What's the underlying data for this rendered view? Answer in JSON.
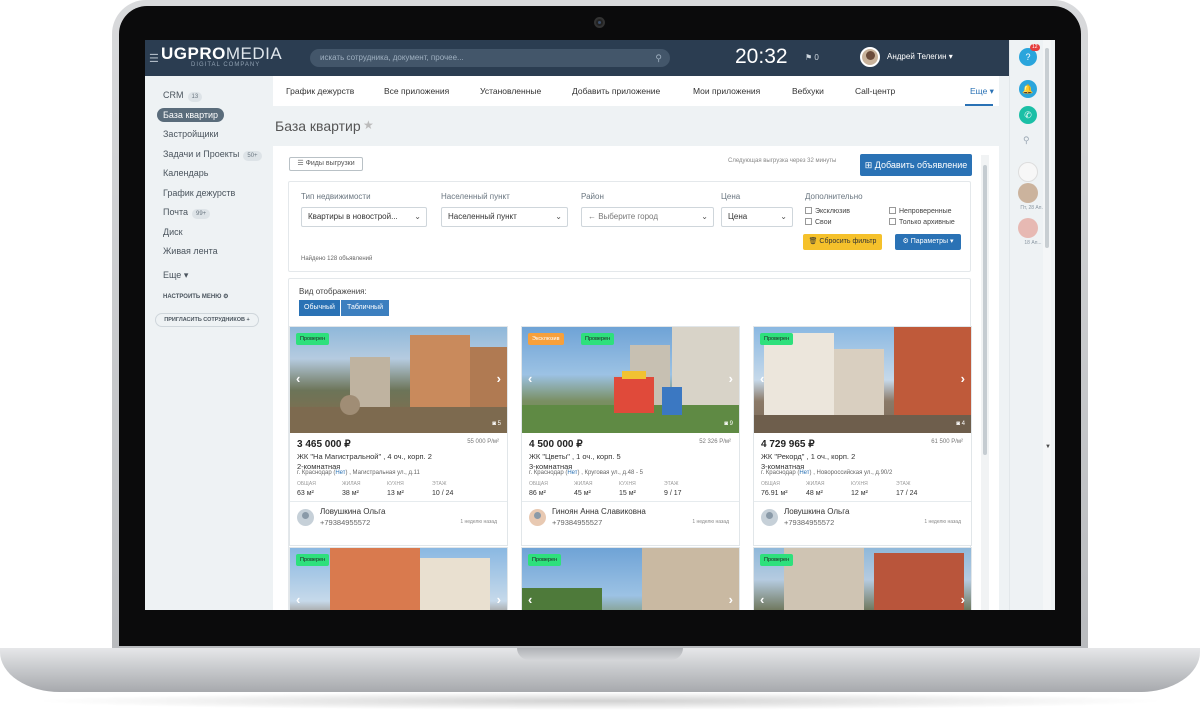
{
  "header": {
    "logo_bold": "UGPRO",
    "logo_thin": "MEDIA",
    "logo_sub": "DIGITAL COMPANY",
    "search_placeholder": "искать сотрудника, документ, прочее...",
    "clock": "20:32",
    "flag_count": "0",
    "user_name": "Андрей Телегин"
  },
  "right_panel": {
    "help_badge": "?",
    "notif_count": "12",
    "user1_time": "Пт, 28 Ап...",
    "user2_time": "18 Ап..."
  },
  "sidebar": {
    "items": [
      {
        "label": "CRM",
        "count": "13"
      },
      {
        "label": "База квартир",
        "count": ""
      },
      {
        "label": "Застройщики",
        "count": ""
      },
      {
        "label": "Задачи и Проекты",
        "count": "50+"
      },
      {
        "label": "Календарь",
        "count": ""
      },
      {
        "label": "График дежурств",
        "count": ""
      },
      {
        "label": "Почта",
        "count": "99+"
      },
      {
        "label": "Диск",
        "count": ""
      },
      {
        "label": "Живая лента",
        "count": ""
      },
      {
        "label": "Еще ▾",
        "count": ""
      }
    ],
    "configure_menu": "НАСТРОИТЬ МЕНЮ",
    "invite": "ПРИГЛАСИТЬ СОТРУДНИКОВ"
  },
  "tabs": [
    "График дежурств",
    "Все приложения",
    "Установленные",
    "Добавить приложение",
    "Мои приложения",
    "Вебхуки",
    "Call-центр",
    "Еще ▾"
  ],
  "page_title": "База квартир",
  "toolbar": {
    "feeds_button": "☰ Фиды выгрузки",
    "next_export": "Следующая выгрузка через 32 минуты",
    "add_button": "Добавить объявление"
  },
  "filter": {
    "type_label": "Тип недвижимости",
    "type_value": "Квартиры в новострой...",
    "city_label": "Населенный пункт",
    "city_value": "Населенный пункт",
    "district_label": "Район",
    "district_value": "← Выберите город",
    "price_label": "Цена",
    "price_value": "Цена",
    "extra_label": "Дополнительно",
    "cb_exclusive": "Эксклюзив",
    "cb_own": "Свои",
    "cb_unverified": "Непроверенные",
    "cb_archived": "Только архивные",
    "reset_button": "Сбросить фильтр",
    "params_button": "Параметры ▾",
    "found": "Найдено 128 объявлений"
  },
  "view": {
    "label": "Вид отображения:",
    "normal": "Обычный",
    "table": "Табличный"
  },
  "cards": [
    {
      "badges": [
        "Проверен"
      ],
      "photos": "5",
      "price": "3 465 000 ₽",
      "ppm": "55 000 Р/м²",
      "complex": "ЖК \"На Магистральной\" , 4 оч., корп. 2",
      "rooms": "2-комнатная",
      "addr_pre": "г. Краснодар (",
      "addr_link": "Нет",
      "addr_post": ") , Магистральная ул., д.11",
      "total": "63 м²",
      "living": "38 м²",
      "kitchen": "13 м²",
      "floor": "10 / 24",
      "agent": "Ловушкина Ольга",
      "phone": "+79384955572",
      "time": "1 неделю назад"
    },
    {
      "badges": [
        "Эксклюзив",
        "Проверен"
      ],
      "photos": "9",
      "price": "4 500 000 ₽",
      "ppm": "52 326 Р/м²",
      "complex": "ЖК \"Цветы\" , 1 оч., корп. 5",
      "rooms": "3-комнатная",
      "addr_pre": "г. Краснодар (",
      "addr_link": "Нет",
      "addr_post": ") , Круговая ул., д.48 - 5",
      "total": "86 м²",
      "living": "45 м²",
      "kitchen": "15 м²",
      "floor": "9 / 17",
      "agent": "Гиноян Анна Славиковна",
      "phone": "+79384955527",
      "time": "1 неделю назад"
    },
    {
      "badges": [
        "Проверен"
      ],
      "photos": "4",
      "price": "4 729 965 ₽",
      "ppm": "61 500 Р/м²",
      "complex": "ЖК \"Рекорд\" , 1 оч., корп. 2",
      "rooms": "3-комнатная",
      "addr_pre": "г. Краснодар (",
      "addr_link": "Нет",
      "addr_post": ") , Новороссийская ул., д.90/2",
      "total": "76.91 м²",
      "living": "48 м²",
      "kitchen": "12 м²",
      "floor": "17 / 24",
      "agent": "Ловушкина Ольга",
      "phone": "+79384955572",
      "time": "1 неделю назад"
    },
    {
      "badges": [
        "Проверен"
      ]
    },
    {
      "badges": [
        "Проверен"
      ]
    },
    {
      "badges": [
        "Проверен"
      ]
    }
  ],
  "stat_labels": {
    "total": "ОБЩАЯ",
    "living": "ЖИЛАЯ",
    "kitchen": "КУХНЯ",
    "floor": "ЭТАЖ"
  },
  "colors": {
    "topbar": "#2b3d51",
    "accent": "#2a72b5",
    "verified": "#2ee07c",
    "exclusive": "#f7a03b",
    "reset": "#f5c12b"
  }
}
